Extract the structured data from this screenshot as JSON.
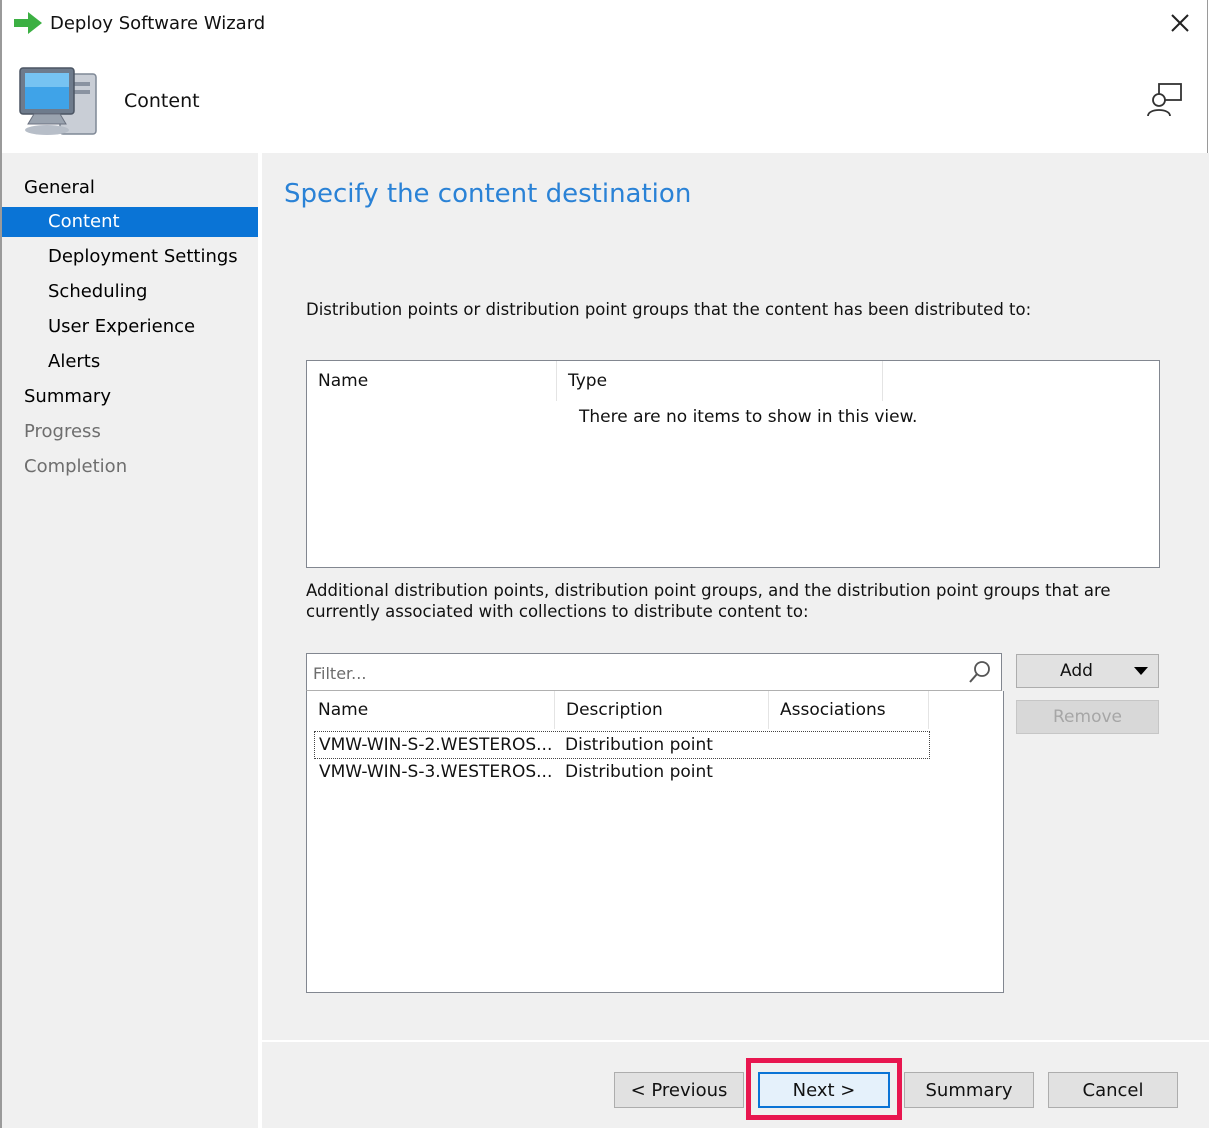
{
  "window": {
    "title": "Deploy Software Wizard"
  },
  "header": {
    "title": "Content"
  },
  "nav": {
    "items": [
      {
        "label": "General",
        "level": 1,
        "state": "normal"
      },
      {
        "label": "Content",
        "level": 2,
        "state": "active"
      },
      {
        "label": "Deployment Settings",
        "level": 2,
        "state": "normal"
      },
      {
        "label": "Scheduling",
        "level": 2,
        "state": "normal"
      },
      {
        "label": "User Experience",
        "level": 2,
        "state": "normal"
      },
      {
        "label": "Alerts",
        "level": 2,
        "state": "normal"
      },
      {
        "label": "Summary",
        "level": 1,
        "state": "normal"
      },
      {
        "label": "Progress",
        "level": 1,
        "state": "dim"
      },
      {
        "label": "Completion",
        "level": 1,
        "state": "dim"
      }
    ]
  },
  "main": {
    "title": "Specify the content destination",
    "distributed_desc": "Distribution points or distribution point groups that the content has been distributed to:",
    "distributed_list": {
      "columns": [
        "Name",
        "Type"
      ],
      "empty_message": "There are no items to show in this view."
    },
    "additional_desc": "Additional distribution points, distribution point groups, and the distribution point groups that are currently associated with collections to distribute content to:",
    "filter": {
      "placeholder": "Filter...",
      "value": ""
    },
    "additional_list": {
      "columns": [
        "Name",
        "Description",
        "Associations"
      ],
      "rows": [
        {
          "name": "VMW-WIN-S-2.WESTEROS...",
          "description": "Distribution point",
          "associations": ""
        },
        {
          "name": "VMW-WIN-S-3.WESTEROS...",
          "description": "Distribution point",
          "associations": ""
        }
      ]
    },
    "add_label": "Add",
    "remove_label": "Remove"
  },
  "footer": {
    "previous_label": "< Previous",
    "next_label": "Next >",
    "summary_label": "Summary",
    "cancel_label": "Cancel"
  },
  "colors": {
    "accent": "#0a74d6",
    "title_blue": "#2a82d6",
    "highlight": "#e8164f",
    "panel_bg": "#f0f0f0"
  }
}
